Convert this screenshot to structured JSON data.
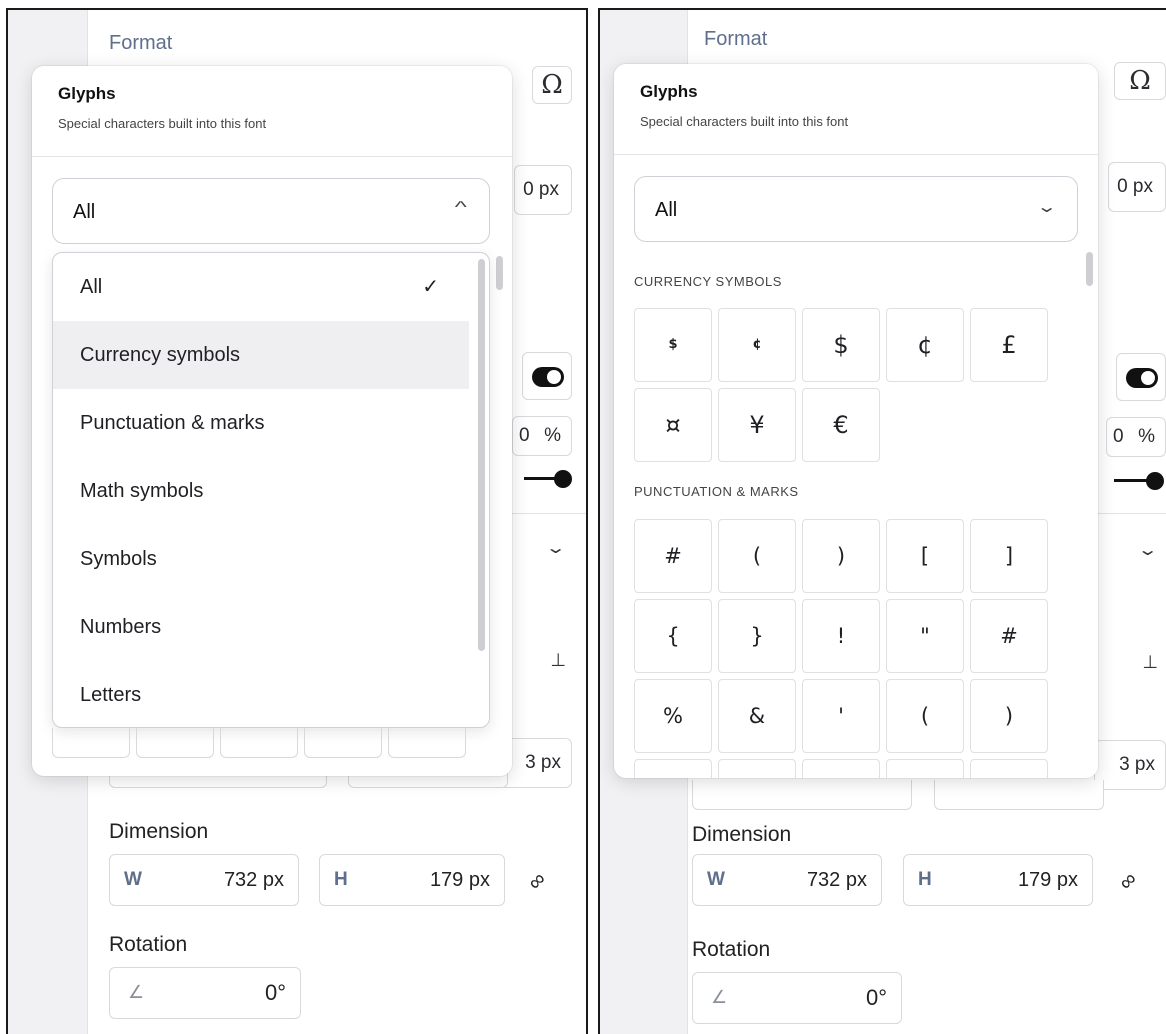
{
  "sidebar": {
    "format_title": "Format",
    "omega_glyph": "Ω",
    "px_snippet": "0 px",
    "pct_snippet": "0",
    "pct_sign": "%",
    "px3_snippet": "3 px",
    "dimension": {
      "label": "Dimension",
      "w_label": "W",
      "w_value": "732 px",
      "h_label": "H",
      "h_value": "179 px"
    },
    "rotation": {
      "label": "Rotation",
      "value": "0°"
    }
  },
  "popover": {
    "title": "Glyphs",
    "subtitle": "Special characters built into this font",
    "selected": "All"
  },
  "dropdown": {
    "items": [
      {
        "label": "All",
        "selected": true
      },
      {
        "label": "Currency symbols",
        "hover": true
      },
      {
        "label": "Punctuation & marks"
      },
      {
        "label": "Math symbols"
      },
      {
        "label": "Symbols"
      },
      {
        "label": "Numbers"
      },
      {
        "label": "Letters"
      }
    ],
    "check": "✓"
  },
  "glyph_sections": [
    {
      "title": "CURRENCY SYMBOLS",
      "glyphs": [
        "$",
        "¢",
        "$",
        "¢",
        "£",
        "¤",
        "¥",
        "€"
      ]
    },
    {
      "title": "PUNCTUATION & MARKS",
      "glyphs": [
        "#",
        "(",
        ")",
        "[",
        "]",
        "{",
        "}",
        "!",
        "\"",
        "#",
        "%",
        "&",
        "'",
        "(",
        ")"
      ]
    }
  ]
}
